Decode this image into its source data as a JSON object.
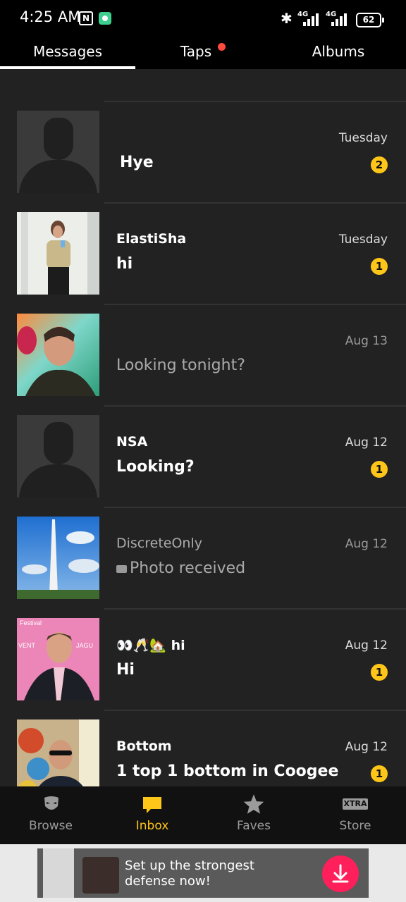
{
  "status": {
    "time": "4:25 AM",
    "battery": "62",
    "network1": "4G",
    "network2": "4G"
  },
  "tabs": [
    {
      "label": "Messages",
      "active": true
    },
    {
      "label": "Taps",
      "has_dot": true
    },
    {
      "label": "Albums"
    }
  ],
  "conversations": [
    {
      "name": "",
      "message": "Hye",
      "time": "Tuesday",
      "unread": "2",
      "avatar": "silhouette"
    },
    {
      "name": "ElastiSha",
      "message": "hi",
      "time": "Tuesday",
      "unread": "1",
      "avatar": "photo-woman"
    },
    {
      "name": "",
      "message": "Looking tonight?",
      "time": "Aug 13",
      "unread": "",
      "avatar": "photo-man-selfie",
      "read": true
    },
    {
      "name": "NSA",
      "message": "Looking?",
      "time": "Aug 12",
      "unread": "1",
      "avatar": "silhouette"
    },
    {
      "name": "DiscreteOnly",
      "message": "Photo received",
      "time": "Aug 12",
      "unread": "",
      "avatar": "photo-monument",
      "read": true,
      "message_icon": "camera-icon"
    },
    {
      "name": "👀🥂🏡 hi",
      "message": "Hi",
      "time": "Aug 12",
      "unread": "1",
      "avatar": "photo-man-event"
    },
    {
      "name": "Bottom",
      "message": "1 top 1 bottom in Coogee",
      "time": "Aug 12",
      "unread": "1",
      "avatar": "photo-man-glasses"
    }
  ],
  "bottom_nav": [
    {
      "label": "Browse",
      "icon": "mask-icon"
    },
    {
      "label": "Inbox",
      "icon": "chat-bubble-icon",
      "active": true
    },
    {
      "label": "Faves",
      "icon": "star-icon"
    },
    {
      "label": "Store",
      "icon": "xtra-icon",
      "icon_text": "XTRA"
    }
  ],
  "ad": {
    "text": "Set up the strongest defense now!"
  },
  "colors": {
    "accent": "#ffc61a",
    "background": "#222222",
    "tab_dot": "#ff4b3e"
  }
}
